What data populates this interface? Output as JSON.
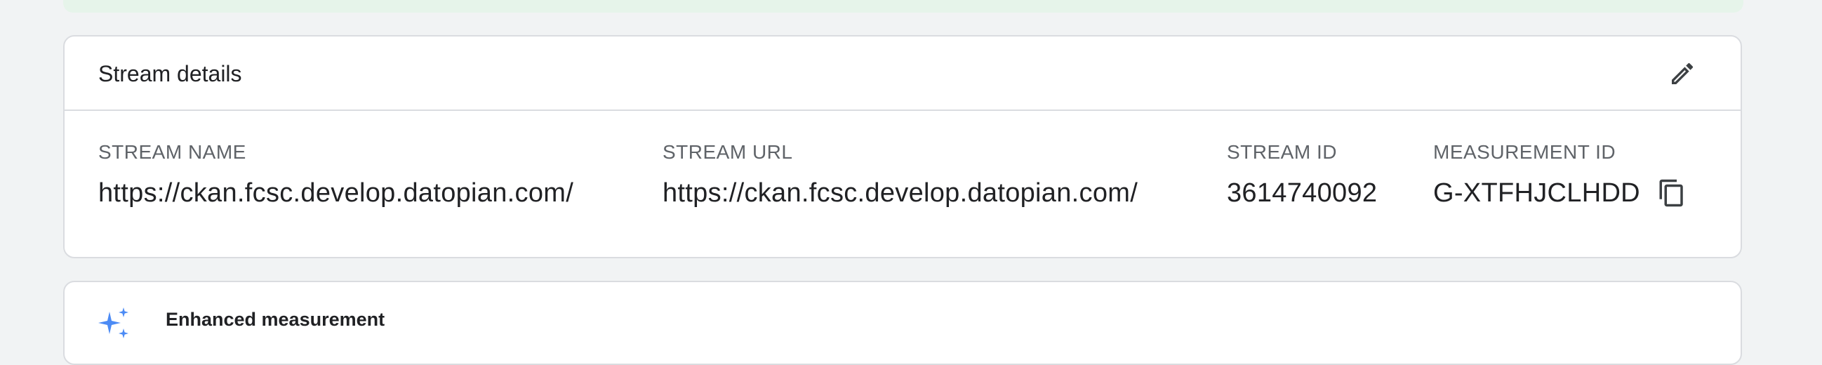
{
  "stream_details": {
    "title": "Stream details",
    "edit_icon": "pencil-icon",
    "fields": [
      {
        "label": "STREAM NAME",
        "value": "https://ckan.fcsc.develop.datopian.com/"
      },
      {
        "label": "STREAM URL",
        "value": "https://ckan.fcsc.develop.datopian.com/"
      },
      {
        "label": "STREAM ID",
        "value": "3614740092"
      },
      {
        "label": "MEASUREMENT ID",
        "value": "G-XTFHJCLHDD"
      }
    ],
    "copy_icon": "copy-icon"
  },
  "enhanced_measurement": {
    "title": "Enhanced measurement",
    "icon": "sparkle-icon",
    "icon_color": "#4c8bf5"
  },
  "colors": {
    "page_background": "#f1f3f4",
    "banner": "#e6f4ea",
    "card_border": "#dadce0",
    "text_primary": "#202124",
    "text_secondary": "#5f6368"
  }
}
